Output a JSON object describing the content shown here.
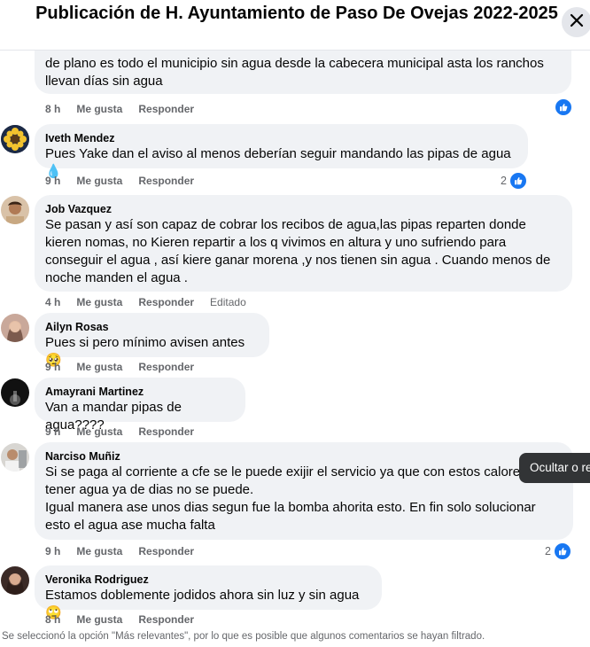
{
  "header": {
    "title": "Publicación de H. Ayuntamiento de Paso De Ovejas 2022-2025"
  },
  "actions": {
    "like": "Me gusta",
    "reply": "Responder"
  },
  "comments": [
    {
      "author": "",
      "text": "de plano es todo el municipio sin agua desde la cabecera municipal asta los ranchos llevan días sin agua",
      "time": "8 h",
      "reactions": "",
      "edited": ""
    },
    {
      "author": "Iveth Mendez",
      "text": "Pues Yake dan el aviso al menos deberían seguir mandando las pipas de agua 💧",
      "time": "9 h",
      "reactions": "2",
      "edited": ""
    },
    {
      "author": "Job Vazquez",
      "text": "Se pasan y así son capaz de cobrar los recibos de agua,las pipas reparten donde kieren nomas, no Kieren repartir a los q vivimos en altura y uno sufriendo para conseguir el agua , así kiere ganar morena ,y nos tienen sin agua . Cuando menos de noche manden el agua .",
      "time": "4 h",
      "reactions": "",
      "edited": "Editado"
    },
    {
      "author": "Ailyn Rosas",
      "text": "Pues si pero mínimo avisen antes 🥺",
      "time": "9 h",
      "reactions": "",
      "edited": ""
    },
    {
      "author": "Amayrani Martinez",
      "text": "Van a mandar pipas de agua????",
      "time": "9 h",
      "reactions": "",
      "edited": ""
    },
    {
      "author": "Narciso Muñiz",
      "text": "Si se paga al corriente a cfe se le puede exijir el servicio ya que con estos calores y sin tener agua ya de dias no se puede.\nIgual manera ase unos dias segun fue la bomba ahorita esto. En fin solo solucionar esto el agua ase mucha falta",
      "time": "9 h",
      "reactions": "2",
      "edited": ""
    },
    {
      "author": "Veronika Rodriguez",
      "text": "Estamos doblemente jodidos ahora sin luz y sin agua🙄",
      "time": "8 h",
      "reactions": "",
      "edited": ""
    }
  ],
  "tooltip": "Ocultar o re",
  "footer_note": "Se seleccionó la opción \"Más relevantes\", por lo que es posible que algunos comentarios se hayan filtrado.",
  "colors": {
    "like_blue": "#1877f2",
    "bubble_bg": "#f0f2f5",
    "meta_gray": "#65676b"
  }
}
